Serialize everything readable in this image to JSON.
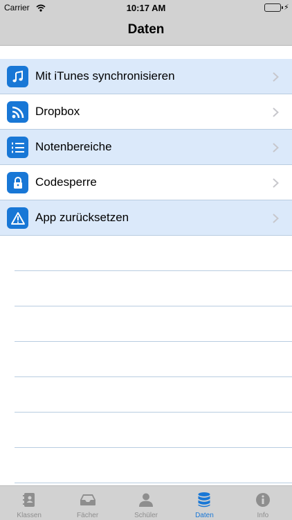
{
  "status_bar": {
    "carrier": "Carrier",
    "time": "10:17 AM"
  },
  "nav": {
    "title": "Daten"
  },
  "menu": [
    {
      "label": "Mit iTunes synchronisieren",
      "icon": "music-note-icon"
    },
    {
      "label": "Dropbox",
      "icon": "feed-icon"
    },
    {
      "label": "Notenbereiche",
      "icon": "numbered-list-icon"
    },
    {
      "label": "Codesperre",
      "icon": "lock-icon"
    },
    {
      "label": "App zurücksetzen",
      "icon": "warning-icon"
    }
  ],
  "tabs": [
    {
      "label": "Klassen",
      "icon": "address-book-icon",
      "active": false
    },
    {
      "label": "Fächer",
      "icon": "inbox-tray-icon",
      "active": false
    },
    {
      "label": "Schüler",
      "icon": "person-icon",
      "active": false
    },
    {
      "label": "Daten",
      "icon": "database-icon",
      "active": true
    },
    {
      "label": "Info",
      "icon": "info-icon",
      "active": false
    }
  ],
  "colors": {
    "accent": "#1877d6",
    "row_highlight": "#dbe9fa",
    "bar_gray": "#d2d2d2",
    "separator": "#b8cce0",
    "inactive_tab": "#8e8e8e"
  }
}
